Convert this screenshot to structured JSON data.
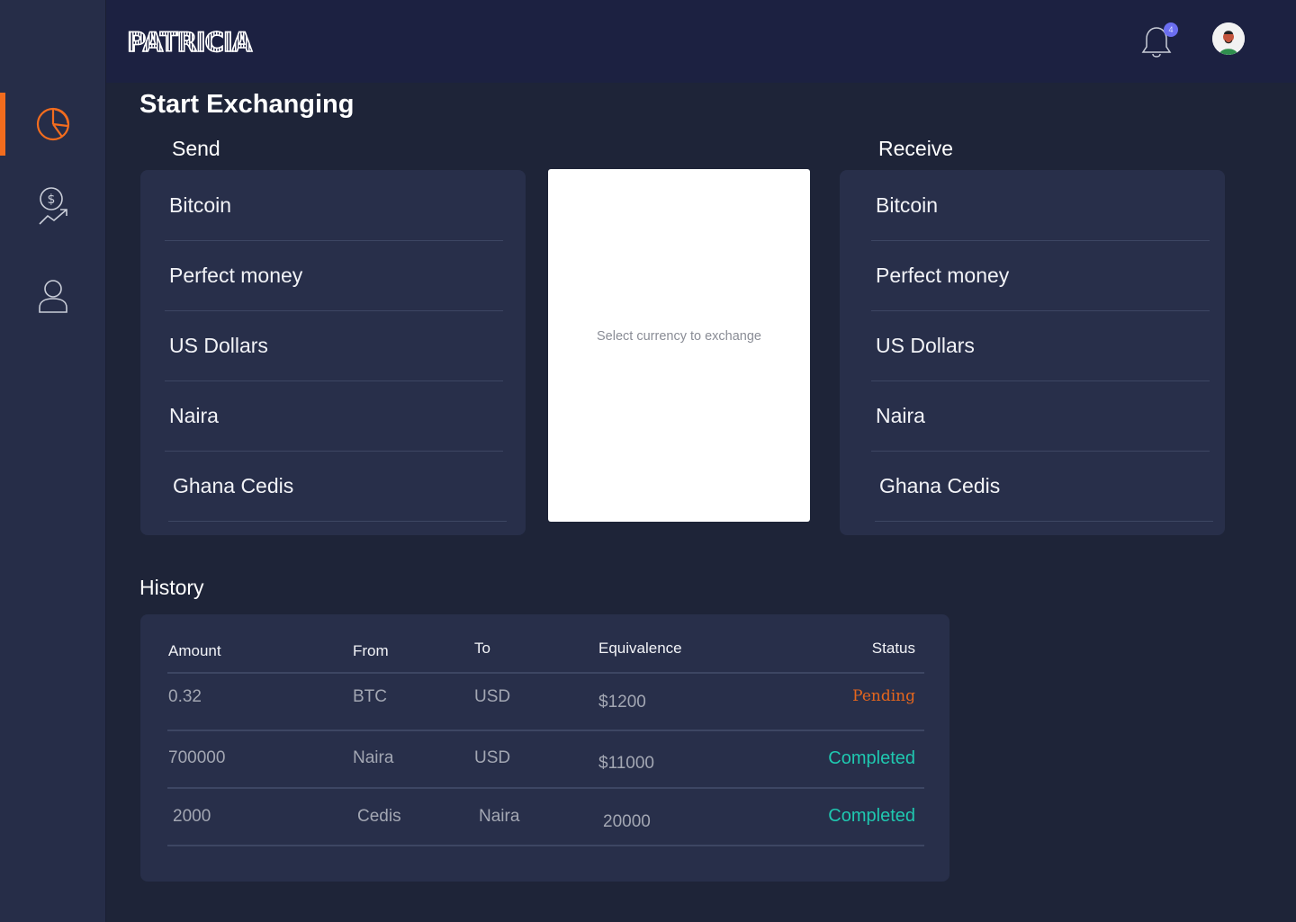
{
  "app": {
    "logo": "PATRICIA",
    "notification_count": "4"
  },
  "sidebar": {
    "items": [
      {
        "icon": "pie-chart-icon",
        "active": true
      },
      {
        "icon": "money-growth-icon",
        "active": false
      },
      {
        "icon": "user-icon",
        "active": false
      }
    ]
  },
  "main": {
    "title": "Start Exchanging",
    "send_label": "Send",
    "receive_label": "Receive",
    "send_currencies": [
      "Bitcoin",
      "Perfect money",
      "US Dollars",
      "Naira",
      "Ghana Cedis"
    ],
    "receive_currencies": [
      "Bitcoin",
      "Perfect money",
      "US Dollars",
      "Naira",
      "Ghana Cedis"
    ],
    "exchange_placeholder": "Select currency to exchange"
  },
  "history": {
    "title": "History",
    "headers": {
      "amount": "Amount",
      "from": "From",
      "to": "To",
      "equivalence": "Equivalence",
      "status": "Status"
    },
    "rows": [
      {
        "amount": "0.32",
        "from": "BTC",
        "to": "USD",
        "equivalence": "$1200",
        "status": "Pending"
      },
      {
        "amount": "700000",
        "from": "Naira",
        "to": "USD",
        "equivalence": "$11000",
        "status": "Completed"
      },
      {
        "amount": "2000",
        "from": "Cedis",
        "to": "Naira",
        "equivalence": "20000",
        "status": "Completed"
      }
    ]
  },
  "colors": {
    "accent": "#f26c1e",
    "pending": "#e5661d",
    "completed": "#1fc8b0",
    "background": "#1e2438",
    "panel": "#282f4a",
    "header": "#1c2141"
  }
}
